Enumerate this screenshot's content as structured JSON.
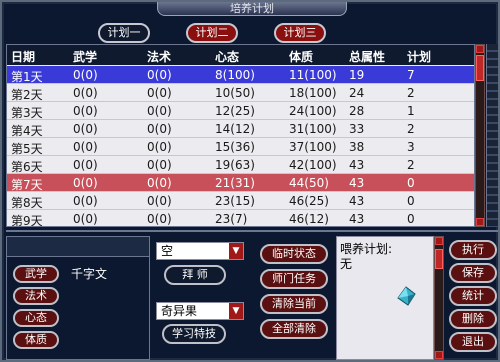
{
  "window": {
    "title": "培养计划"
  },
  "tabs": [
    {
      "label": "计划一"
    },
    {
      "label": "计划二"
    },
    {
      "label": "计划三"
    }
  ],
  "table": {
    "headers": [
      "日期",
      "武学",
      "法术",
      "心态",
      "体质",
      "总属性",
      "计划"
    ],
    "rows": [
      [
        "第1天",
        "0(0)",
        "0(0)",
        "8(100)",
        "11(100)",
        "19",
        "7"
      ],
      [
        "第2天",
        "0(0)",
        "0(0)",
        "10(50)",
        "18(100)",
        "24",
        "2"
      ],
      [
        "第3天",
        "0(0)",
        "0(0)",
        "12(25)",
        "24(100)",
        "28",
        "1"
      ],
      [
        "第4天",
        "0(0)",
        "0(0)",
        "14(12)",
        "31(100)",
        "33",
        "2"
      ],
      [
        "第5天",
        "0(0)",
        "0(0)",
        "15(36)",
        "37(100)",
        "38",
        "3"
      ],
      [
        "第6天",
        "0(0)",
        "0(0)",
        "19(63)",
        "42(100)",
        "43",
        "2"
      ],
      [
        "第7天",
        "0(0)",
        "0(0)",
        "21(31)",
        "44(50)",
        "43",
        "0"
      ],
      [
        "第8天",
        "0(0)",
        "0(0)",
        "23(15)",
        "46(25)",
        "43",
        "0"
      ],
      [
        "第9天",
        "0(0)",
        "0(0)",
        "23(7)",
        "46(12)",
        "43",
        "0"
      ]
    ]
  },
  "attributes": {
    "buttons": [
      "武学",
      "法术",
      "心态",
      "体质"
    ],
    "selected_value": "千字文"
  },
  "middle": {
    "select1_value": "空",
    "master_button": "拜 师",
    "select2_value": "奇异果",
    "learn_button": "学习特技"
  },
  "status_buttons": [
    "临时状态",
    "师门任务",
    "清除当前",
    "全部清除"
  ],
  "feed": {
    "label": "喂养计划:",
    "value": "无",
    "item_icon": "crystal-item-icon"
  },
  "actions": [
    "执行",
    "保存",
    "统计",
    "删除",
    "退出"
  ],
  "colors": {
    "selected_row": "#3a3ad8",
    "highlight_row": "#c8505a",
    "button_red": "#5a1010"
  }
}
